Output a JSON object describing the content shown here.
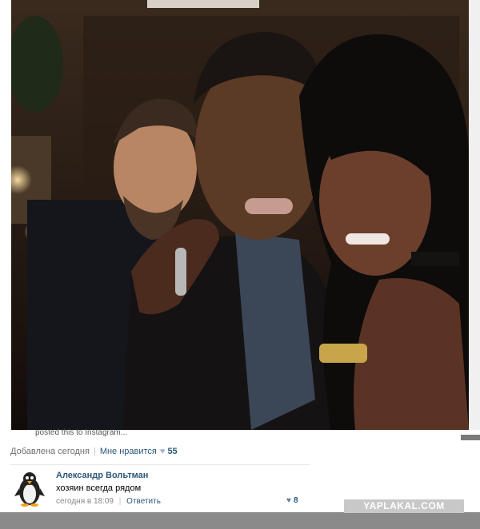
{
  "post": {
    "caption_cut": "posted this to Instagram...",
    "added": "Добавлена сегодня",
    "like_label": "Мне нравится",
    "likes": "55"
  },
  "comment": {
    "author": "Александр Вольтман",
    "text": "хозяин всегда рядом",
    "time": "сегодня в 18:09",
    "reply": "Ответить",
    "likes": "8"
  },
  "watermark": "YAPLAKAL.COM",
  "icons": {
    "like": "heart-icon",
    "avatar": "penguin-avatar"
  },
  "colors": {
    "link": "#2b587a",
    "meta": "#6f6f6f"
  }
}
